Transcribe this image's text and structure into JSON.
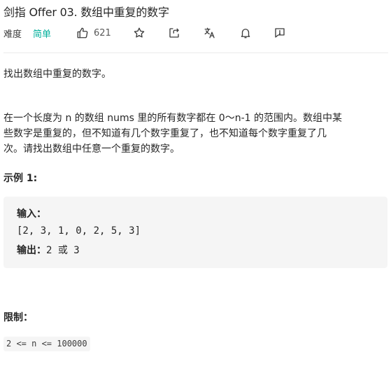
{
  "problem": {
    "title": "剑指 Offer 03. 数组中重复的数字"
  },
  "meta": {
    "difficulty_label": "难度",
    "difficulty_value": "简单",
    "likes": "621",
    "colors": {
      "easy": "#00af9b",
      "icon": "#3c3c3c"
    },
    "icons": [
      "thumbs-up-icon",
      "star-icon",
      "share-icon",
      "translate-icon",
      "bell-icon",
      "feedback-icon"
    ]
  },
  "description": {
    "intro": "找出数组中重复的数字。",
    "body_line1": "在一个长度为 n 的数组 nums 里的所有数字都在 0～n-1 的范围内。数组中某",
    "body_line2": "些数字是重复的，但不知道有几个数字重复了，也不知道每个数字重复了几",
    "body_line3": "次。请找出数组中任意一个重复的数字。"
  },
  "example": {
    "heading": "示例 1:",
    "input_label": "输入：",
    "input_value": "[2, 3, 1, 0, 2, 5, 3]",
    "output_label": "输出：",
    "output_value": "2 或 3"
  },
  "constraints": {
    "heading": "限制：",
    "value": "2 <= n <= 100000"
  }
}
